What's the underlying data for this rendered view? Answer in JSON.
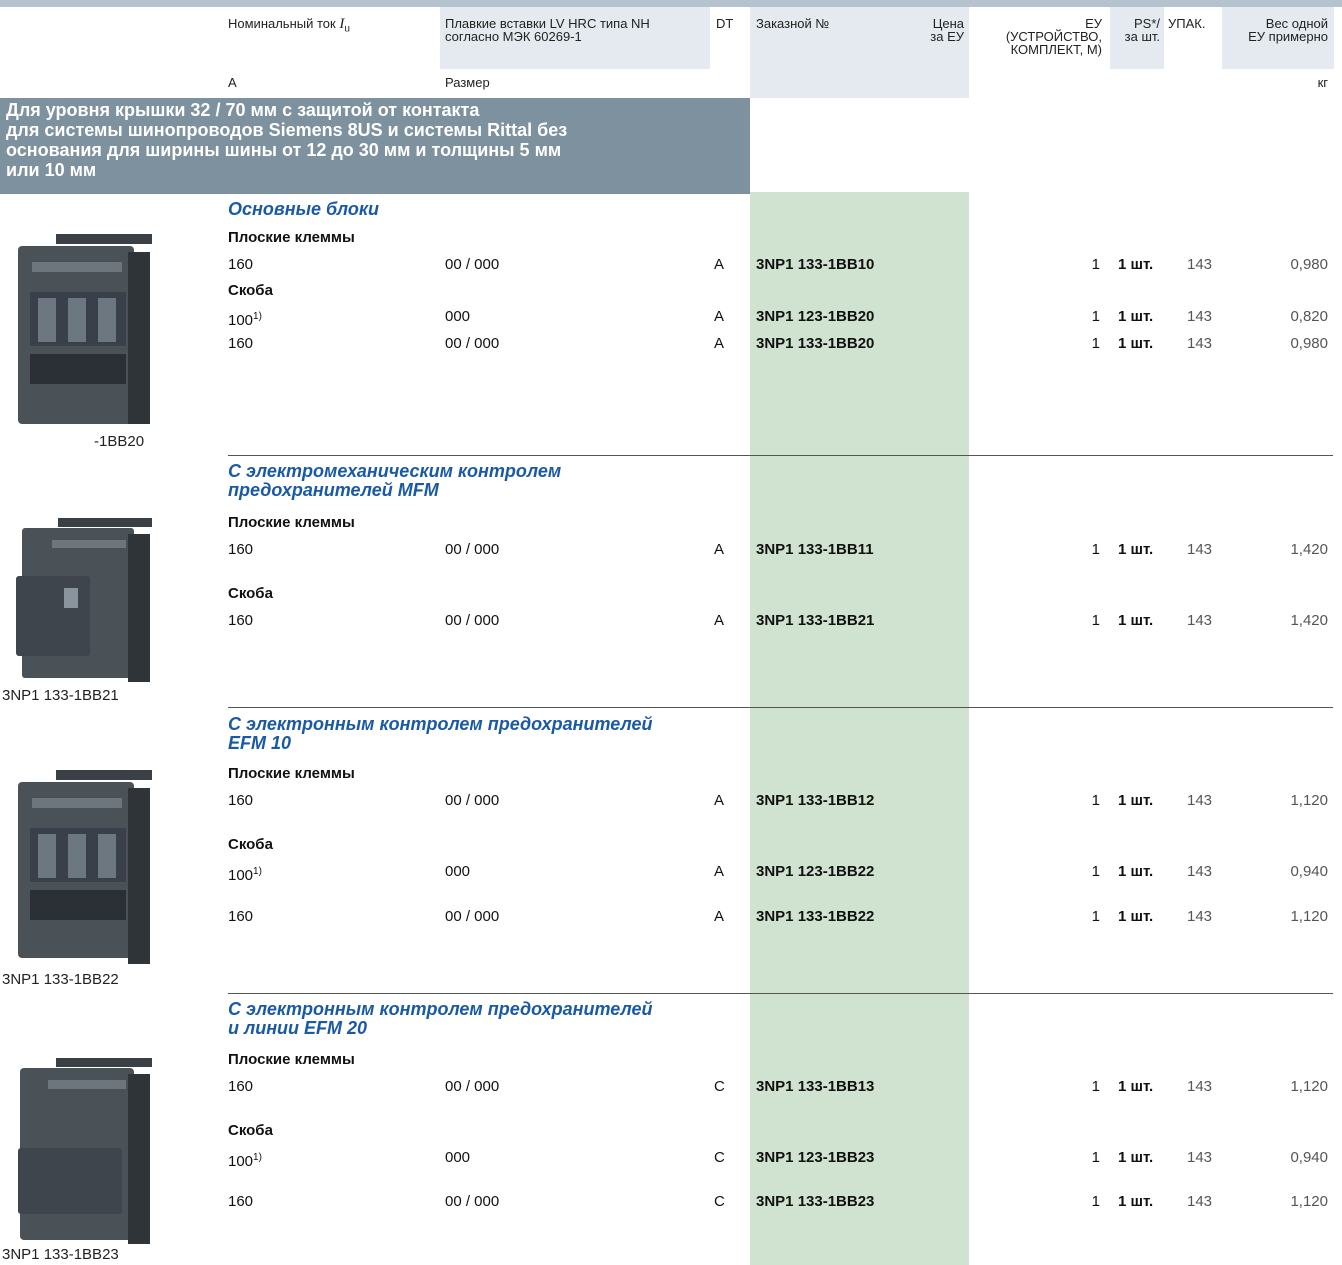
{
  "headers": {
    "current_pre": "Номинальный ток ",
    "current_sym": "I",
    "current_sub": "u",
    "fuse_l1": "Плавкие вставки LV HRC типа NH",
    "fuse_l2": "согласно МЭК 60269-1",
    "dt": "DT",
    "order": "Заказной №",
    "price_l1": "Цена",
    "price_l2": "за ЕУ",
    "unit_l1": "ЕУ",
    "unit_l2": "(УСТРОЙСТВО,",
    "unit_l3": "КОМПЛЕКТ, М)",
    "ps_l1": "PS*/",
    "ps_l2": "за шт.",
    "pack": "УПАК.",
    "weight_l1": "Вес одной",
    "weight_l2": "ЕУ примерно",
    "unit_a": "А",
    "unit_size": "Размер",
    "unit_kg": "кг"
  },
  "banner": {
    "l1": "Для уровня крышки 32 / 70 мм с защитой от контакта",
    "l2": "для системы шинопроводов Siemens 8US и системы Rittal без",
    "l3": "основания для ширины шины от 12 до 30 мм и толщины 5 мм",
    "l4": "или 10 мм"
  },
  "sections": [
    {
      "title_l1": "Основные блоки",
      "title_l2": "",
      "caption": "-1BB20",
      "sub1": "Плоские клеммы",
      "sub2": "Скоба",
      "rows": [
        {
          "current": "160",
          "sup": "",
          "size": "00 / 000",
          "dt": "A",
          "order": "3NP1 133-1BB10",
          "unit": "1",
          "ps": "1 шт.",
          "pack": "143",
          "weight": "0,980"
        },
        {
          "current": "100",
          "sup": "1)",
          "size": "000",
          "dt": "A",
          "order": "3NP1 123-1BB20",
          "unit": "1",
          "ps": "1 шт.",
          "pack": "143",
          "weight": "0,820"
        },
        {
          "current": "160",
          "sup": "",
          "size": "00 / 000",
          "dt": "A",
          "order": "3NP1 133-1BB20",
          "unit": "1",
          "ps": "1 шт.",
          "pack": "143",
          "weight": "0,980"
        }
      ]
    },
    {
      "title_l1": "С электромеханическим контролем",
      "title_l2": "предохранителей MFM",
      "caption": "3NP1 133-1BB21",
      "sub1": "Плоские клеммы",
      "sub2": "Скоба",
      "rows": [
        {
          "current": "160",
          "sup": "",
          "size": "00 / 000",
          "dt": "A",
          "order": "3NP1 133-1BB11",
          "unit": "1",
          "ps": "1 шт.",
          "pack": "143",
          "weight": "1,420"
        },
        {
          "current": "160",
          "sup": "",
          "size": "00 / 000",
          "dt": "A",
          "order": "3NP1 133-1BB21",
          "unit": "1",
          "ps": "1 шт.",
          "pack": "143",
          "weight": "1,420"
        }
      ]
    },
    {
      "title_l1": "С электронным контролем предохранителей",
      "title_l2": "EFM 10",
      "caption": "3NP1 133-1BB22",
      "sub1": "Плоские клеммы",
      "sub2": "Скоба",
      "rows": [
        {
          "current": "160",
          "sup": "",
          "size": "00 / 000",
          "dt": "A",
          "order": "3NP1 133-1BB12",
          "unit": "1",
          "ps": "1 шт.",
          "pack": "143",
          "weight": "1,120"
        },
        {
          "current": "100",
          "sup": "1)",
          "size": "000",
          "dt": "A",
          "order": "3NP1 123-1BB22",
          "unit": "1",
          "ps": "1 шт.",
          "pack": "143",
          "weight": "0,940"
        },
        {
          "current": "160",
          "sup": "",
          "size": "00 / 000",
          "dt": "A",
          "order": "3NP1 133-1BB22",
          "unit": "1",
          "ps": "1 шт.",
          "pack": "143",
          "weight": "1,120"
        }
      ]
    },
    {
      "title_l1": "С электронным контролем предохранителей",
      "title_l2": "и линии EFM 20",
      "caption": "3NP1 133-1BB23",
      "sub1": "Плоские клеммы",
      "sub2": "Скоба",
      "rows": [
        {
          "current": "160",
          "sup": "",
          "size": "00 / 000",
          "dt": "C",
          "order": "3NP1 133-1BB13",
          "unit": "1",
          "ps": "1 шт.",
          "pack": "143",
          "weight": "1,120"
        },
        {
          "current": "100",
          "sup": "1)",
          "size": "000",
          "dt": "C",
          "order": "3NP1 123-1BB23",
          "unit": "1",
          "ps": "1 шт.",
          "pack": "143",
          "weight": "0,940"
        },
        {
          "current": "160",
          "sup": "",
          "size": "00 / 000",
          "dt": "C",
          "order": "3NP1 133-1BB23",
          "unit": "1",
          "ps": "1 шт.",
          "pack": "143",
          "weight": "1,120"
        }
      ]
    }
  ]
}
